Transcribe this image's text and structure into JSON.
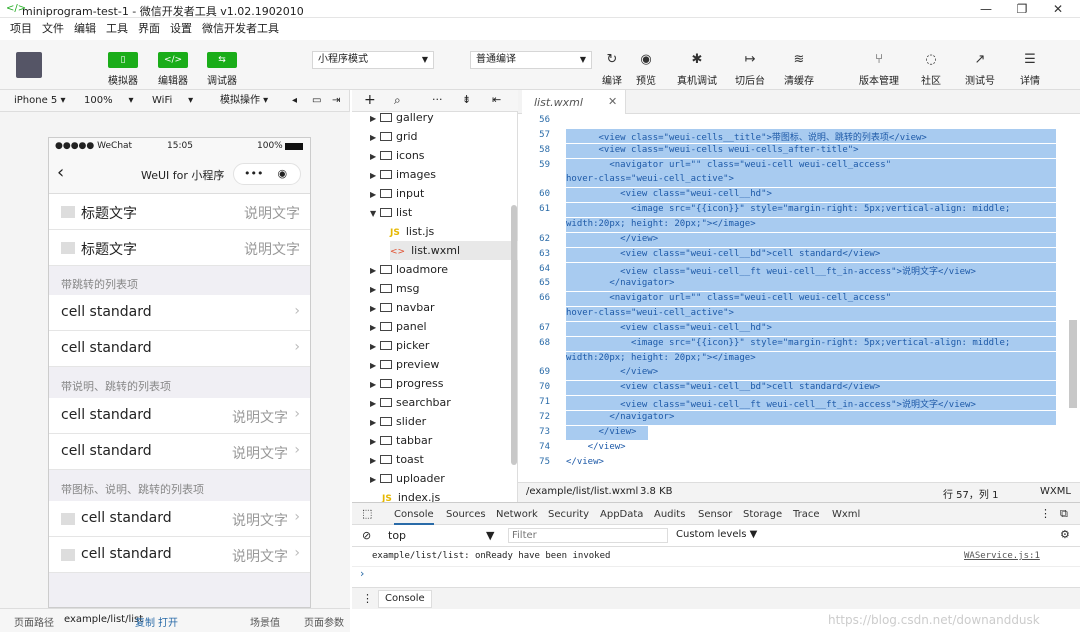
{
  "window": {
    "title": "miniprogram-test-1 - 微信开发者工具 v1.02.1902010",
    "minimize": "—",
    "maximize": "❐",
    "close": "✕"
  },
  "menu": [
    "项目",
    "文件",
    "编辑",
    "工具",
    "界面",
    "设置",
    "微信开发者工具"
  ],
  "toolbar": {
    "simulator": "模拟器",
    "editor": "编辑器",
    "debugger": "调试器",
    "mode": "小程序模式",
    "compile": "普通编译",
    "actions": [
      "编译",
      "预览",
      "真机调试",
      "切后台",
      "清缓存"
    ],
    "right_actions": [
      "版本管理",
      "社区",
      "测试号",
      "详情"
    ]
  },
  "devbar": {
    "device": "iPhone 5",
    "zoom": "100%",
    "network": "WiFi",
    "op": "模拟操作"
  },
  "phone": {
    "carrier": "●●●●● WeChat",
    "time": "15:05",
    "battery": "100%",
    "nav_title": "WeUI for 小程序",
    "cells_top": [
      {
        "label": "标题文字",
        "value": "说明文字"
      },
      {
        "label": "标题文字",
        "value": "说明文字"
      }
    ],
    "group1": "带跳转的列表项",
    "cells_g1": [
      {
        "label": "cell standard"
      },
      {
        "label": "cell standard"
      }
    ],
    "group2": "带说明、跳转的列表项",
    "cells_g2": [
      {
        "label": "cell standard",
        "value": "说明文字"
      },
      {
        "label": "cell standard",
        "value": "说明文字"
      }
    ],
    "group3": "带图标、说明、跳转的列表项",
    "cells_g3": [
      {
        "label": "cell standard",
        "value": "说明文字"
      },
      {
        "label": "cell standard",
        "value": "说明文字"
      }
    ]
  },
  "bottombar": {
    "path_label": "页面路径",
    "path": "example/list/list",
    "copy": "复制",
    "open": "打开",
    "scene": "场景值",
    "params": "页面参数"
  },
  "filetree": {
    "items": [
      "gallery",
      "grid",
      "icons",
      "images",
      "input",
      "list",
      "list.js",
      "list.wxml",
      "loadmore",
      "msg",
      "navbar",
      "panel",
      "picker",
      "preview",
      "progress",
      "searchbar",
      "slider",
      "tabbar",
      "toast",
      "uploader",
      "index.js"
    ]
  },
  "editor": {
    "tab": "list.wxml",
    "lines": [
      {
        "n": "56",
        "code": ""
      },
      {
        "n": "57",
        "code": "      <view class=\"weui-cells__title\">带图标、说明、跳转的列表项</view>"
      },
      {
        "n": "58",
        "code": "      <view class=\"weui-cells weui-cells_after-title\">"
      },
      {
        "n": "59",
        "code": "        <navigator url=\"\" class=\"weui-cell weui-cell_access\""
      },
      {
        "n": "",
        "code": "hover-class=\"weui-cell_active\">"
      },
      {
        "n": "60",
        "code": "          <view class=\"weui-cell__hd\">"
      },
      {
        "n": "61",
        "code": "            <image src=\"{{icon}}\" style=\"margin-right: 5px;vertical-align: middle;"
      },
      {
        "n": "",
        "code": "width:20px; height: 20px;\"></image>"
      },
      {
        "n": "62",
        "code": "          </view>"
      },
      {
        "n": "63",
        "code": "          <view class=\"weui-cell__bd\">cell standard</view>"
      },
      {
        "n": "64",
        "code": "          <view class=\"weui-cell__ft weui-cell__ft_in-access\">说明文字</view>"
      },
      {
        "n": "65",
        "code": "        </navigator>"
      },
      {
        "n": "66",
        "code": "        <navigator url=\"\" class=\"weui-cell weui-cell_access\""
      },
      {
        "n": "",
        "code": "hover-class=\"weui-cell_active\">"
      },
      {
        "n": "67",
        "code": "          <view class=\"weui-cell__hd\">"
      },
      {
        "n": "68",
        "code": "            <image src=\"{{icon}}\" style=\"margin-right: 5px;vertical-align: middle;"
      },
      {
        "n": "",
        "code": "width:20px; height: 20px;\"></image>"
      },
      {
        "n": "69",
        "code": "          </view>"
      },
      {
        "n": "70",
        "code": "          <view class=\"weui-cell__bd\">cell standard</view>"
      },
      {
        "n": "71",
        "code": "          <view class=\"weui-cell__ft weui-cell__ft_in-access\">说明文字</view>"
      },
      {
        "n": "72",
        "code": "        </navigator>"
      },
      {
        "n": "73",
        "code": "      </view>"
      },
      {
        "n": "74",
        "code": "    </view>"
      },
      {
        "n": "75",
        "code": "</view>"
      }
    ],
    "status_path": "/example/list/list.wxml",
    "status_size": "3.8 KB",
    "status_pos": "行 57，列 1",
    "status_lang": "WXML"
  },
  "console": {
    "tabs": [
      "Console",
      "Sources",
      "Network",
      "Security",
      "AppData",
      "Audits",
      "Sensor",
      "Storage",
      "Trace",
      "Wxml"
    ],
    "context": "top",
    "filter_placeholder": "Filter",
    "levels": "Custom levels",
    "message": "example/list/list: onReady have been invoked",
    "source": "WAService.js:1",
    "drawer_tab": "Console",
    "watermark": "https://blog.csdn.net/downanddusk"
  },
  "colors": {
    "accent": "#1aad19",
    "selection": "#a8cbf0"
  }
}
